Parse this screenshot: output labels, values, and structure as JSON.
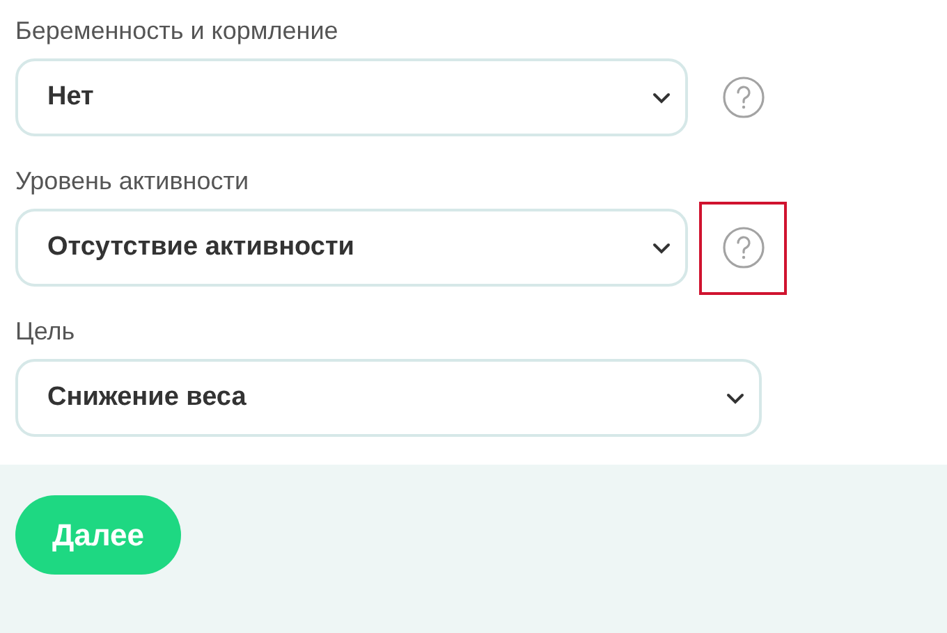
{
  "fields": [
    {
      "label": "Беременность и кормление",
      "value": "Нет",
      "help": true,
      "highlighted": false
    },
    {
      "label": "Уровень активности",
      "value": "Отсутствие активности",
      "help": true,
      "highlighted": true
    },
    {
      "label": "Цель",
      "value": "Снижение веса",
      "help": false,
      "highlighted": false
    }
  ],
  "next_button": "Далее"
}
